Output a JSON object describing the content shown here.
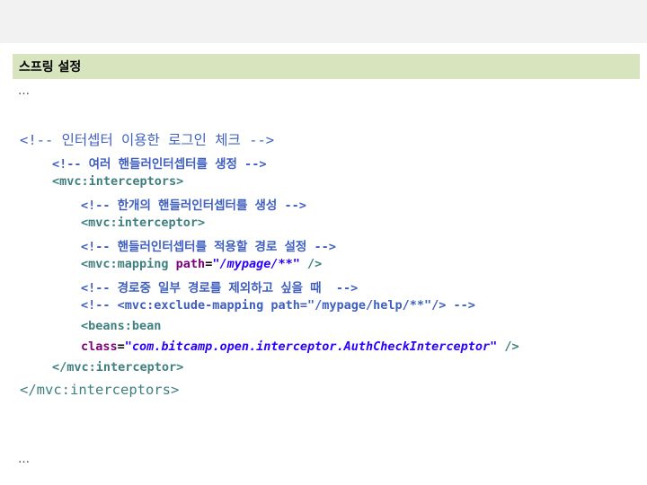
{
  "header": {
    "title": "스프링 설정"
  },
  "ellipsis_top": "…",
  "ellipsis_bottom": "…",
  "code": {
    "l1": "<!-- 인터셉터 이용한 로그인 체크 -->",
    "l2": "<!-- 여러 핸들러인터셉터를 생정 -->",
    "l3": "<mvc:interceptors>",
    "l4": "<!-- 한개의 핸들러인터셉터를 생성 -->",
    "l5": "<mvc:interceptor>",
    "l6": "<!-- 핸들러인터셉터를 적용할 경로 설정 -->",
    "l7_tag": "<mvc:mapping ",
    "l7_attr": "path",
    "l7_eq": "=",
    "l7_val": "\"/mypage/**\"",
    "l7_end": " />",
    "l8": "<!-- 경로중 일부 경로를 제외하고 싶을 때  -->",
    "l9": "<!-- <mvc:exclude-mapping path=\"/mypage/help/**\"/> -->",
    "l10": "<beans:bean",
    "l11_attr": "class",
    "l11_eq": "=",
    "l11_val": "\"com.bitcamp.open.interceptor.AuthCheckInterceptor\"",
    "l11_end": " />",
    "l12": "</mvc:interceptor>",
    "l13": "</mvc:interceptors>"
  }
}
